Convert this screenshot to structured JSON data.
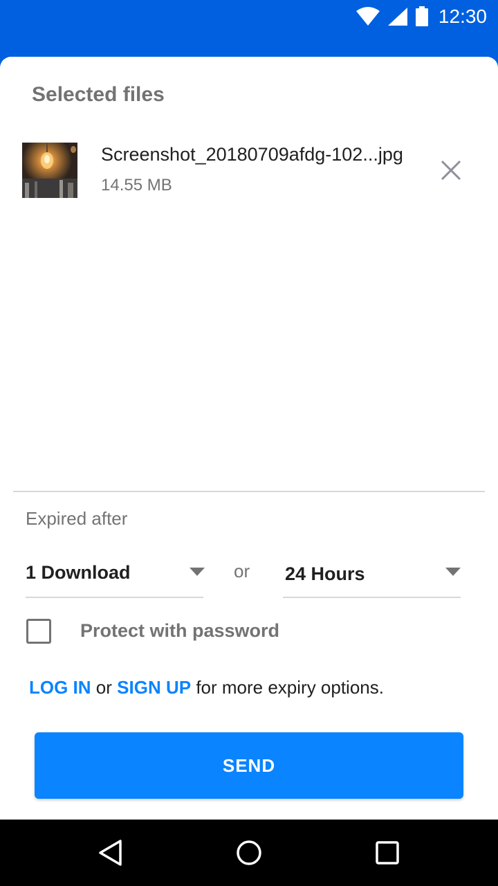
{
  "status_bar": {
    "time": "12:30",
    "icons": [
      "wifi-icon",
      "signal-icon",
      "battery-icon"
    ]
  },
  "files": {
    "title": "Selected files",
    "items": [
      {
        "name": "Screenshot_20180709afdg-102...jpg",
        "size": "14.55 MB",
        "thumbnail": "lightbulb-thumbnail"
      }
    ],
    "remove_icon": "close-icon"
  },
  "expiry": {
    "label": "Expired after",
    "downloads": {
      "value": "1 Download"
    },
    "separator": "or",
    "time": {
      "value": "24 Hours"
    },
    "caret_icon": "caret-down-icon"
  },
  "password": {
    "label": "Protect with password",
    "checked": false
  },
  "account_prompt": {
    "login": "LOG IN",
    "or": "or",
    "signup": "SIGN UP",
    "suffix": "for more expiry options."
  },
  "send_button": {
    "label": "SEND"
  },
  "colors": {
    "brand_blue": "#0060df",
    "link_blue": "#0a84ff",
    "button_blue": "#0a84ff",
    "text_dark": "#202020",
    "text_grey": "#737373"
  },
  "nav": {
    "icons": [
      "back-icon",
      "home-icon",
      "recents-icon"
    ]
  }
}
